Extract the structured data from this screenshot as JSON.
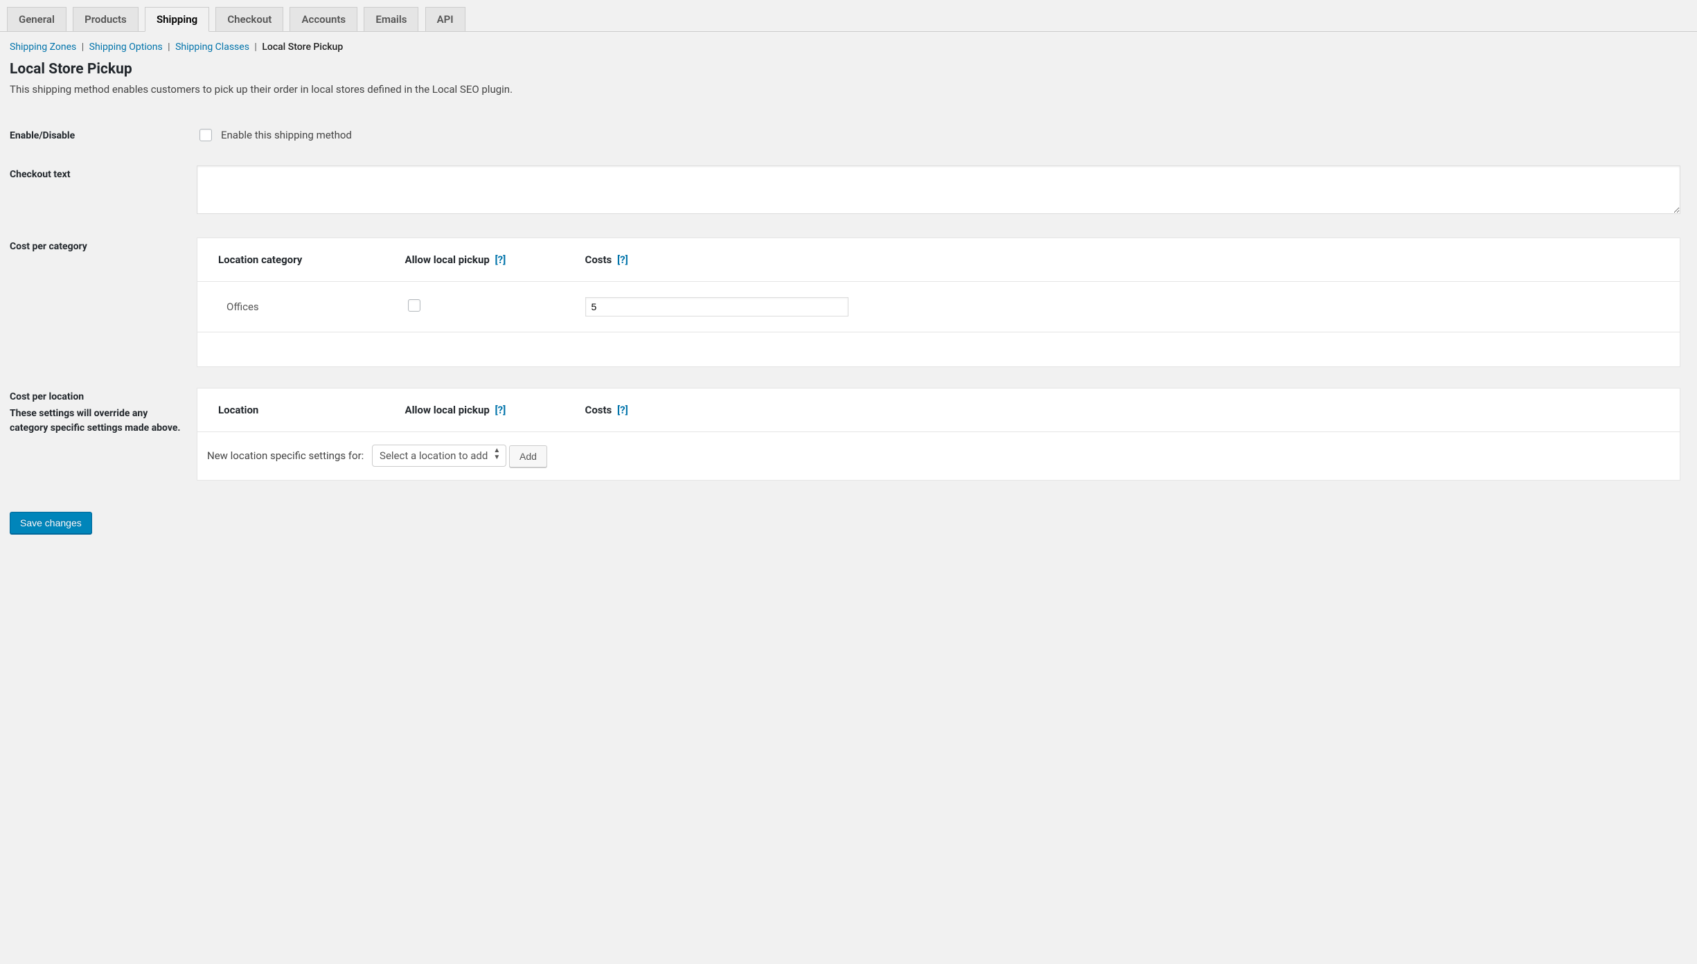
{
  "tabs": {
    "general": "General",
    "products": "Products",
    "shipping": "Shipping",
    "checkout": "Checkout",
    "accounts": "Accounts",
    "emails": "Emails",
    "api": "API",
    "active": "shipping"
  },
  "subnav": {
    "zones": "Shipping Zones",
    "options": "Shipping Options",
    "classes": "Shipping Classes",
    "current": "Local Store Pickup",
    "sep": "|"
  },
  "page": {
    "title": "Local Store Pickup",
    "description": "This shipping method enables customers to pick up their order in local stores defined in the Local SEO plugin."
  },
  "fields": {
    "enable": {
      "label": "Enable/Disable",
      "checkbox_label": "Enable this shipping method"
    },
    "checkout_text": {
      "label": "Checkout text",
      "value": ""
    },
    "cost_per_category": {
      "label": "Cost per category",
      "headers": {
        "category": "Location category",
        "allow": "Allow local pickup",
        "costs": "Costs",
        "help": "[?]"
      },
      "rows": [
        {
          "category": "Offices",
          "allow": false,
          "cost": "5"
        }
      ]
    },
    "cost_per_location": {
      "label": "Cost per location",
      "sub": "These settings will override any category specific settings made above.",
      "headers": {
        "location": "Location",
        "allow": "Allow local pickup",
        "costs": "Costs",
        "help": "[?]"
      },
      "new_label": "New location specific settings for:",
      "select_placeholder": "Select a location to add",
      "add_button": "Add"
    }
  },
  "save_button": "Save changes"
}
